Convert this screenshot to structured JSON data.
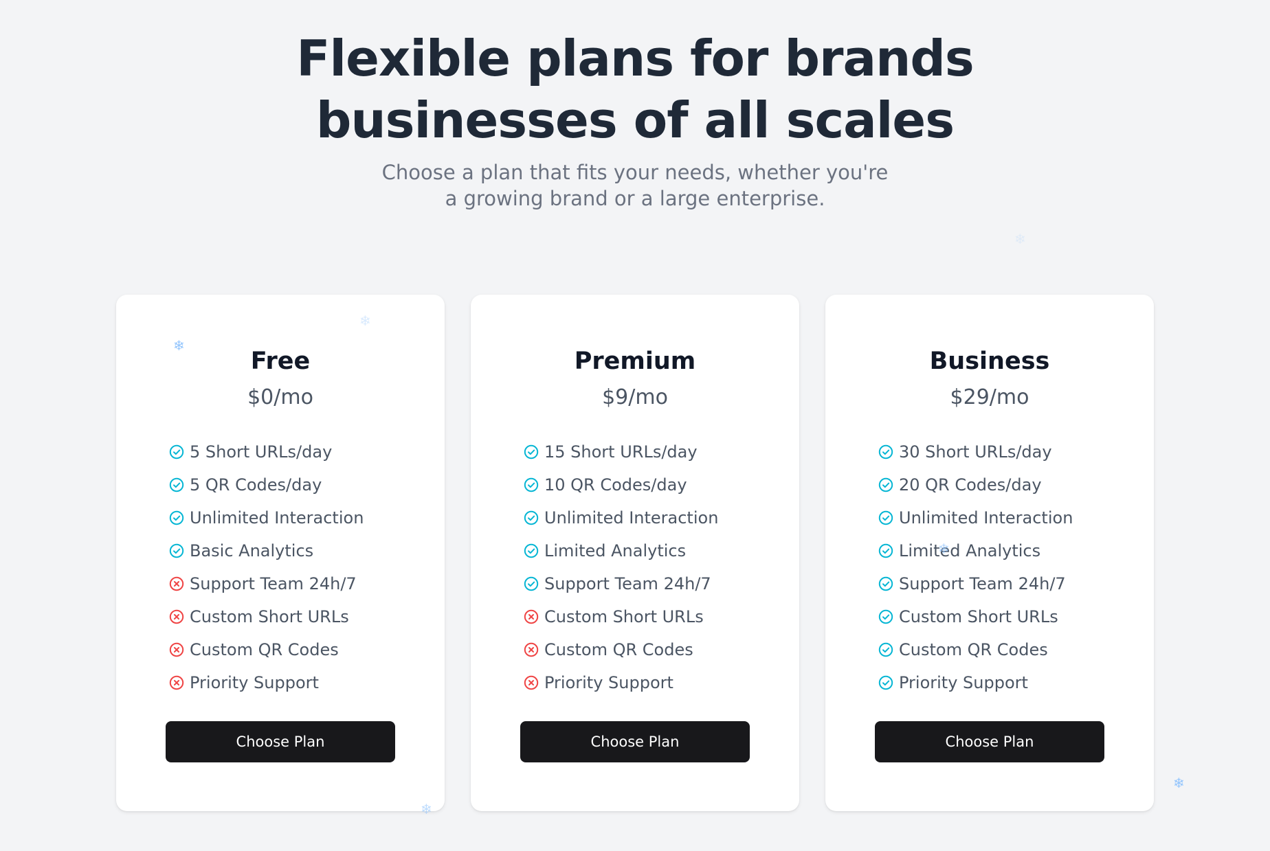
{
  "hero": {
    "title_line1": "Flexible plans for brands",
    "title_line2": "businesses of all scales",
    "subtitle_line1": "Choose a plan that fits your needs, whether you're",
    "subtitle_line2": "a growing brand or a large enterprise."
  },
  "colors": {
    "included": "#06b6d4",
    "excluded": "#ef4444",
    "button": "#18181b",
    "snowflake": "#93c5fd"
  },
  "plans": [
    {
      "name": "Free",
      "price": "$0/mo",
      "button_label": "Choose Plan",
      "features": [
        {
          "label": "5 Short URLs/day",
          "included": true
        },
        {
          "label": "5 QR Codes/day",
          "included": true
        },
        {
          "label": "Unlimited Interaction",
          "included": true
        },
        {
          "label": "Basic Analytics",
          "included": true
        },
        {
          "label": "Support Team 24h/7",
          "included": false
        },
        {
          "label": "Custom Short URLs",
          "included": false
        },
        {
          "label": "Custom QR Codes",
          "included": false
        },
        {
          "label": "Priority Support",
          "included": false
        }
      ]
    },
    {
      "name": "Premium",
      "price": "$9/mo",
      "button_label": "Choose Plan",
      "features": [
        {
          "label": "15 Short URLs/day",
          "included": true
        },
        {
          "label": "10 QR Codes/day",
          "included": true
        },
        {
          "label": "Unlimited Interaction",
          "included": true
        },
        {
          "label": "Limited Analytics",
          "included": true
        },
        {
          "label": "Support Team 24h/7",
          "included": true
        },
        {
          "label": "Custom Short URLs",
          "included": false
        },
        {
          "label": "Custom QR Codes",
          "included": false
        },
        {
          "label": "Priority Support",
          "included": false
        }
      ]
    },
    {
      "name": "Business",
      "price": "$29/mo",
      "button_label": "Choose Plan",
      "features": [
        {
          "label": "30 Short URLs/day",
          "included": true
        },
        {
          "label": "20 QR Codes/day",
          "included": true
        },
        {
          "label": "Unlimited Interaction",
          "included": true
        },
        {
          "label": "Limited Analytics",
          "included": true
        },
        {
          "label": "Support Team 24h/7",
          "included": true
        },
        {
          "label": "Custom Short URLs",
          "included": true
        },
        {
          "label": "Custom QR Codes",
          "included": true
        },
        {
          "label": "Priority Support",
          "included": true
        }
      ]
    }
  ],
  "icons": {
    "included": "check-circle-icon",
    "excluded": "x-circle-icon",
    "decoration": "snowflake-icon",
    "snowflake_glyph": "❄"
  }
}
